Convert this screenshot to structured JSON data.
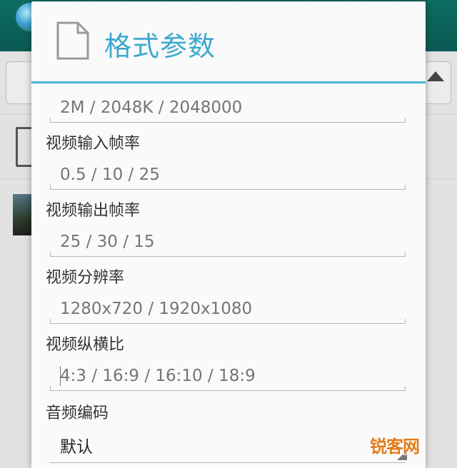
{
  "dialog": {
    "title": "格式参数",
    "icon": "document-icon"
  },
  "fields": [
    {
      "label": "",
      "value": "",
      "placeholder": "2M / 2048K / 2048000"
    },
    {
      "label": "视频输入帧率",
      "value": "",
      "placeholder": "0.5 / 10 / 25"
    },
    {
      "label": "视频输出帧率",
      "value": "",
      "placeholder": "25 / 30 / 15"
    },
    {
      "label": "视频分辨率",
      "value": "",
      "placeholder": "1280x720 / 1920x1080"
    },
    {
      "label": "视频纵横比",
      "value": "",
      "placeholder": "4:3 / 16:9 / 16:10 / 18:9"
    }
  ],
  "audio_codec": {
    "label": "音频编码",
    "selected": "默认"
  },
  "watermark": "锐客网",
  "colors": {
    "accent": "#3ba9cf",
    "divider": "#4db3d6",
    "watermark": "#e07a1a"
  }
}
